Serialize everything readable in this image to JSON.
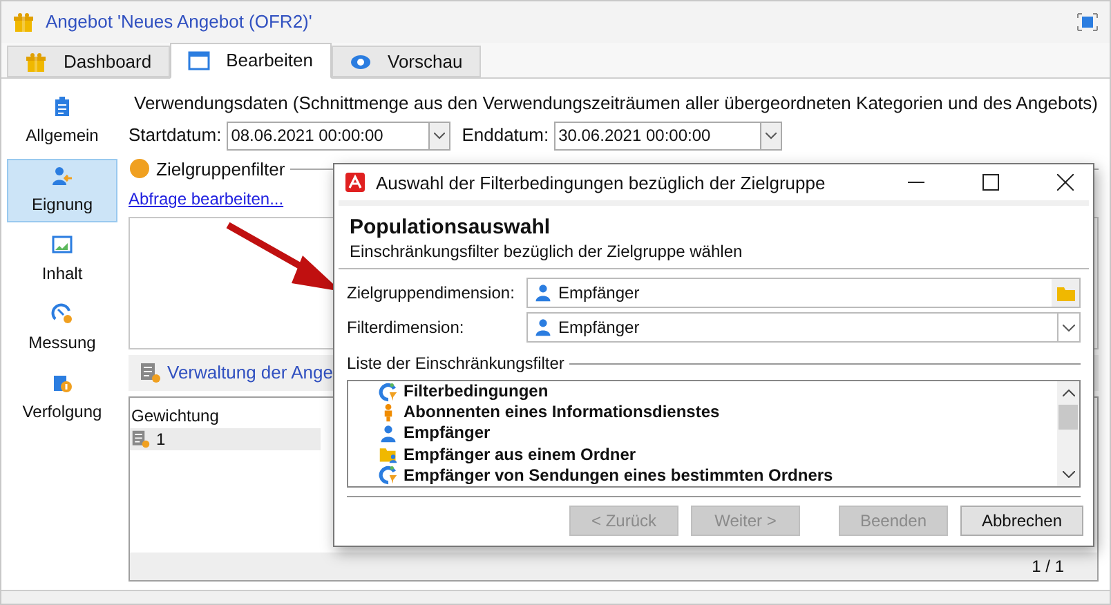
{
  "window": {
    "title": "Angebot 'Neues Angebot (OFR2)'"
  },
  "tabs": [
    {
      "label": "Dashboard",
      "selected": false,
      "kind": "gift"
    },
    {
      "label": "Bearbeiten",
      "selected": true,
      "kind": "form"
    },
    {
      "label": "Vorschau",
      "selected": false,
      "kind": "eye"
    }
  ],
  "sidebar": {
    "items": [
      {
        "label": "Allgemein",
        "selected": false,
        "kind": "clipboard"
      },
      {
        "label": "Eignung",
        "selected": true,
        "kind": "people"
      },
      {
        "label": "Inhalt",
        "selected": false,
        "kind": "chart"
      },
      {
        "label": "Messung",
        "selected": false,
        "kind": "gauge"
      },
      {
        "label": "Verfolgung",
        "selected": false,
        "kind": "info"
      }
    ]
  },
  "validity": {
    "heading": "Verwendungsdaten (Schnittmenge aus den Verwendungszeiträumen aller übergeordneten Kategorien und des Angebots)",
    "start_label": "Startdatum:",
    "start_value": "08.06.2021 00:00:00",
    "end_label": "Enddatum:",
    "end_value": "30.06.2021 00:00:00"
  },
  "target": {
    "heading": "Zielgruppenfilter",
    "link": "Abfrage bearbeiten..."
  },
  "offers": {
    "toolbar_label": "Verwaltung der Ange",
    "column_1": "Gewichtung",
    "rows": [
      {
        "weight": "1"
      }
    ],
    "pager": "1 / 1"
  },
  "dialog": {
    "title": "Auswahl der Filterbedingungen bezüglich der Zielgruppe",
    "heading": "Populationsauswahl",
    "subtitle": "Einschränkungsfilter bezüglich der Zielgruppe wählen",
    "target_dimension_label": "Zielgruppendimension:",
    "target_dimension_value": "Empfänger",
    "filter_dimension_label": "Filterdimension:",
    "filter_dimension_value": "Empfänger",
    "list_label": "Liste der Einschränkungsfilter",
    "filters": [
      {
        "label": "Filterbedingungen",
        "kind": "filter"
      },
      {
        "label": "Abonnenten eines Informationsdienstes",
        "kind": "subscriber"
      },
      {
        "label": "Empfänger",
        "kind": "person"
      },
      {
        "label": "Empfänger aus einem Ordner",
        "kind": "folder"
      },
      {
        "label": "Empfänger von Sendungen eines bestimmten Ordners",
        "kind": "filter"
      }
    ],
    "buttons": [
      {
        "label": "< Zurück",
        "disabled": true
      },
      {
        "label": "Weiter >",
        "disabled": true
      },
      {
        "label": "Beenden",
        "disabled": true
      },
      {
        "label": "Abbrechen",
        "disabled": false
      }
    ]
  }
}
